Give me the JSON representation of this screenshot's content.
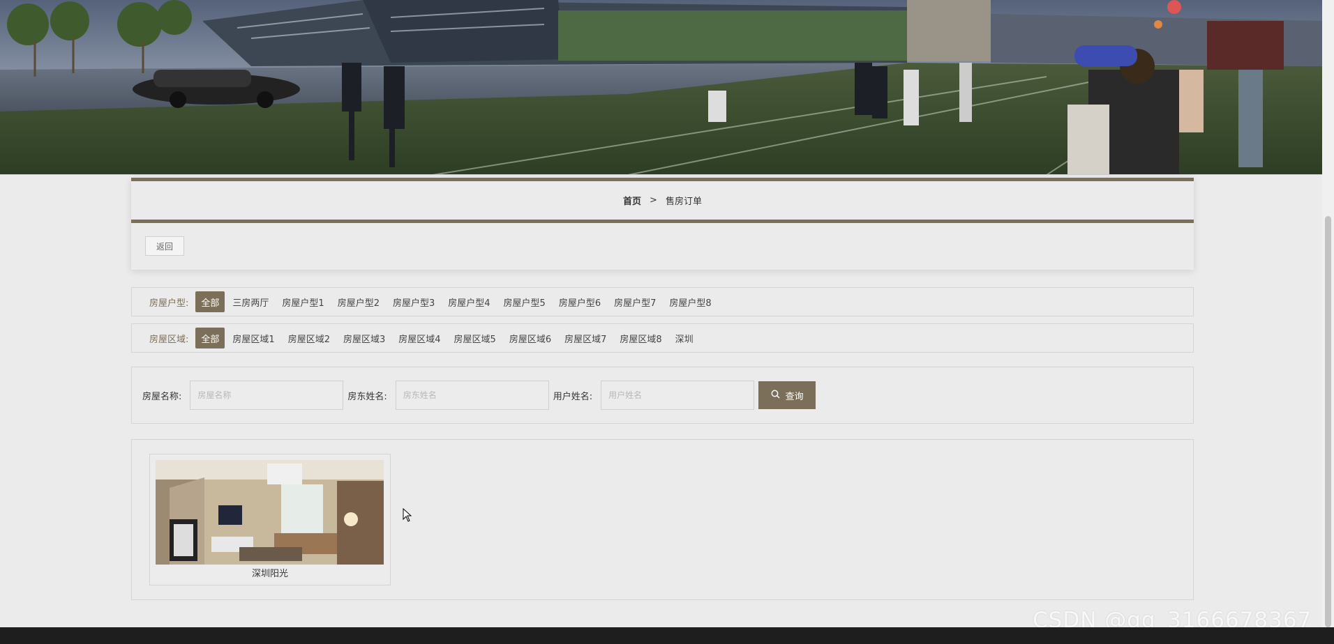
{
  "breadcrumb": {
    "home": "首页",
    "separator": ">",
    "current": "售房订单"
  },
  "back_button": "返回",
  "filters": {
    "type": {
      "label": "房屋户型:",
      "options": [
        "全部",
        "三房两厅",
        "房屋户型1",
        "房屋户型2",
        "房屋户型3",
        "房屋户型4",
        "房屋户型5",
        "房屋户型6",
        "房屋户型7",
        "房屋户型8"
      ],
      "selected": "全部"
    },
    "area": {
      "label": "房屋区域:",
      "options": [
        "全部",
        "房屋区域1",
        "房屋区域2",
        "房屋区域3",
        "房屋区域4",
        "房屋区域5",
        "房屋区域6",
        "房屋区域7",
        "房屋区域8",
        "深圳"
      ],
      "selected": "全部"
    }
  },
  "search": {
    "name_label": "房屋名称:",
    "name_placeholder": "房屋名称",
    "landlord_label": "房东姓名:",
    "landlord_placeholder": "房东姓名",
    "user_label": "用户姓名:",
    "user_placeholder": "用户姓名",
    "button_label": "查询"
  },
  "results": [
    {
      "title": "深圳阳光"
    }
  ],
  "watermark": "CSDN @qq_3166678367",
  "colors": {
    "accent": "#7c6f59",
    "background": "#ebebeb",
    "border": "#d4d4d4"
  }
}
